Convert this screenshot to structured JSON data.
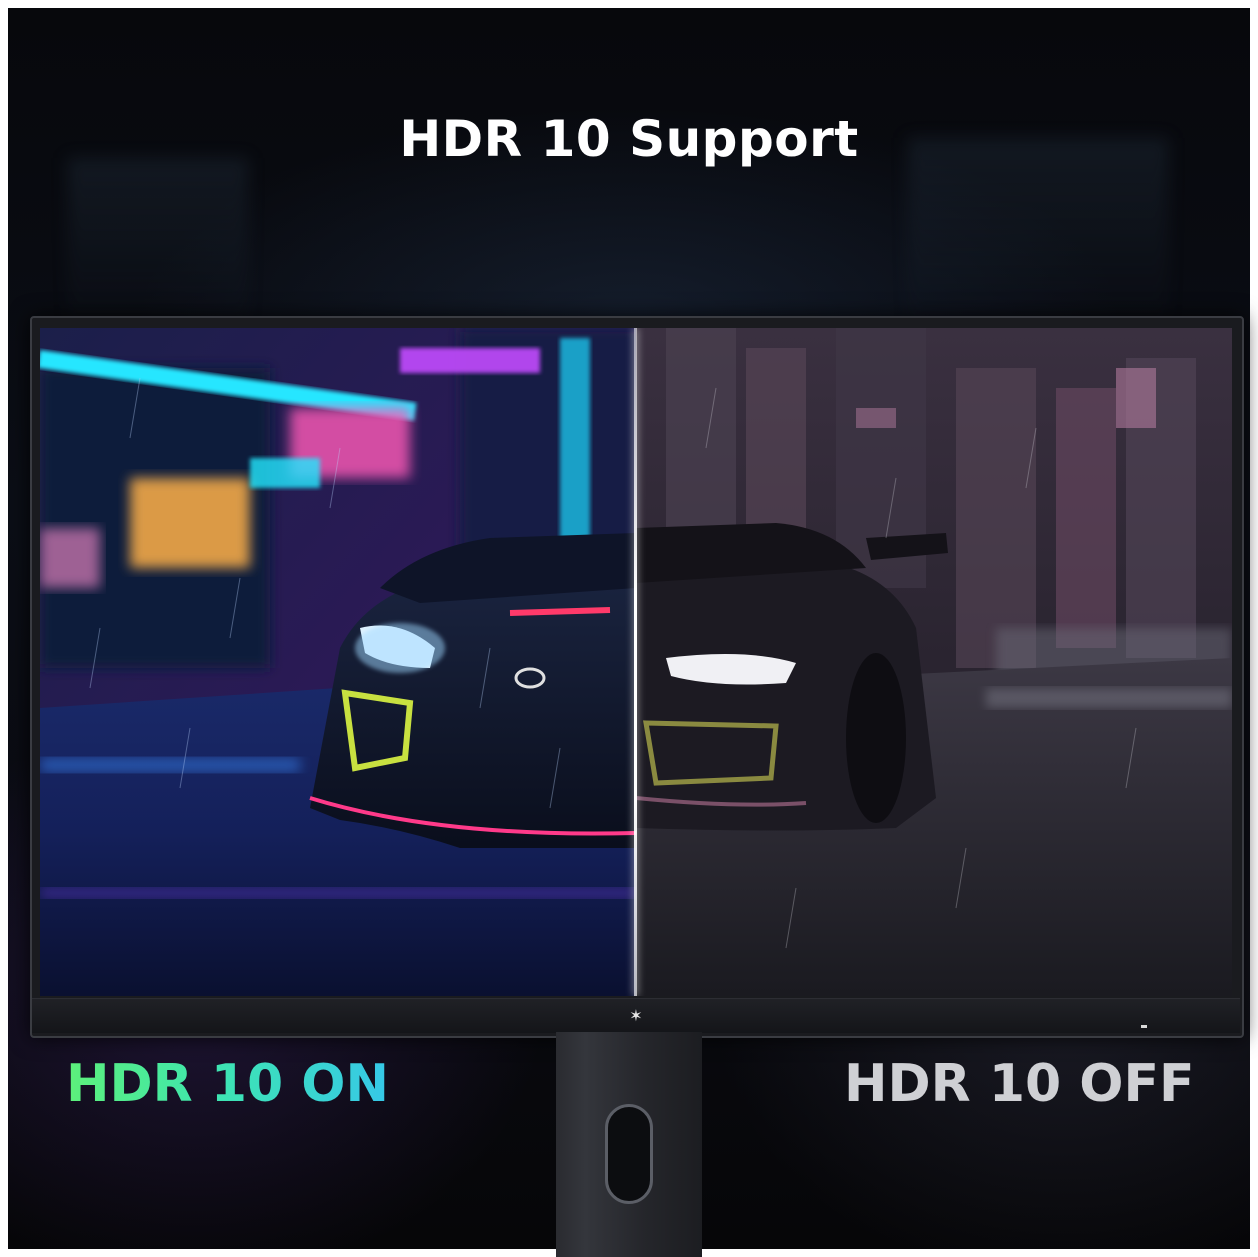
{
  "title": "HDR 10 Support",
  "labels": {
    "on": "HDR 10 ON",
    "off": "HDR 10 OFF"
  },
  "monitor": {
    "logo_icon": "brand-logo-icon"
  },
  "colors": {
    "on_gradient_start": "#5df07a",
    "on_gradient_end": "#36c8e8",
    "off_label": "#cfd0d4",
    "background": "#05060a"
  }
}
